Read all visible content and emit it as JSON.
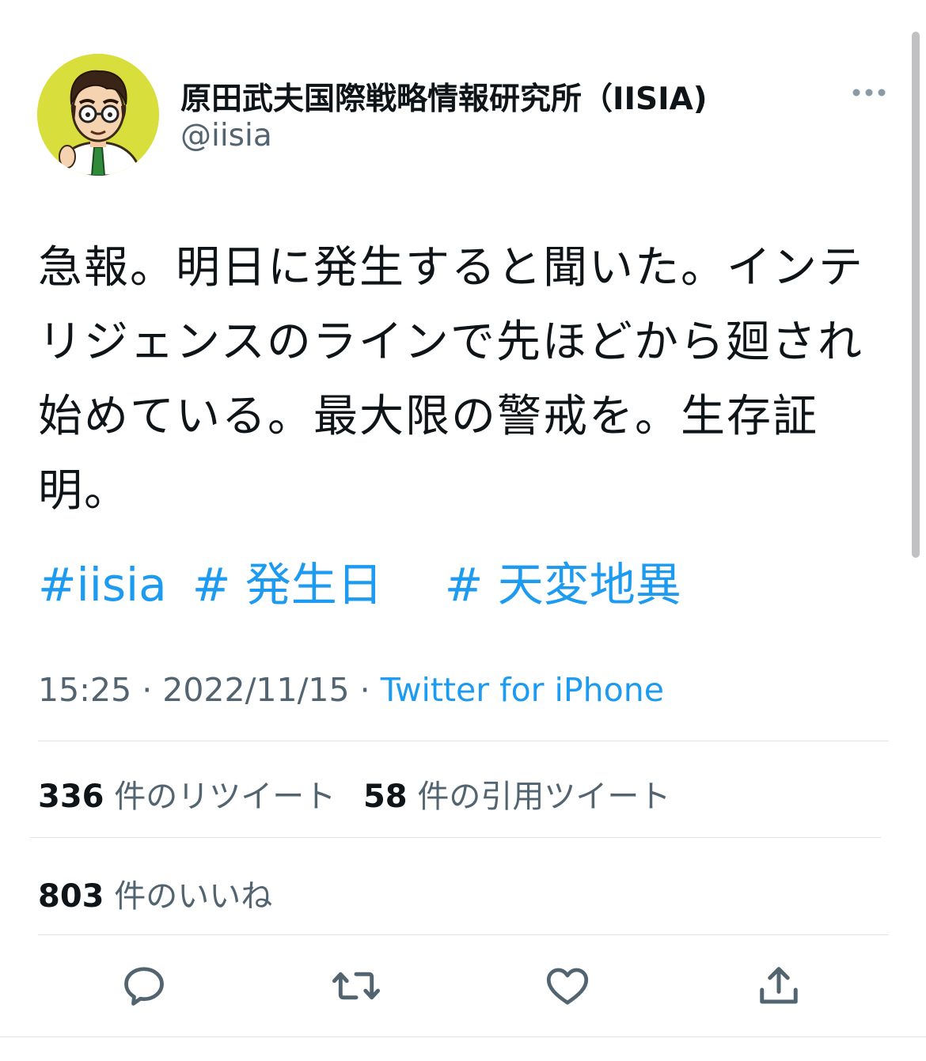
{
  "user": {
    "display_name": "原田武夫国際戦略情報研究所（IISIA)",
    "handle": "@iisia"
  },
  "tweet": {
    "text": "急報。明日に発生すると聞いた。インテリジェンスのラインで先ほどから廻され始めている。最大限の警戒を。生存証明。",
    "hashtags": [
      "#iisia",
      "# 発生日",
      "# 天変地異"
    ]
  },
  "meta": {
    "time": "15:25",
    "separator1": " · ",
    "date": "2022/11/15",
    "separator2": " · ",
    "source": "Twitter for iPhone"
  },
  "stats": {
    "retweets": {
      "count": "336",
      "label": "件のリツイート"
    },
    "quotes": {
      "count": "58",
      "label": "件の引用ツイート"
    },
    "likes": {
      "count": "803",
      "label": "件のいいね"
    }
  },
  "actions": {
    "icons": [
      "reply-icon",
      "retweet-icon",
      "like-icon",
      "share-icon"
    ]
  },
  "colors": {
    "accent": "#1d9bf0",
    "secondary_text": "#536471",
    "avatar_bg": "#d8df3c"
  }
}
